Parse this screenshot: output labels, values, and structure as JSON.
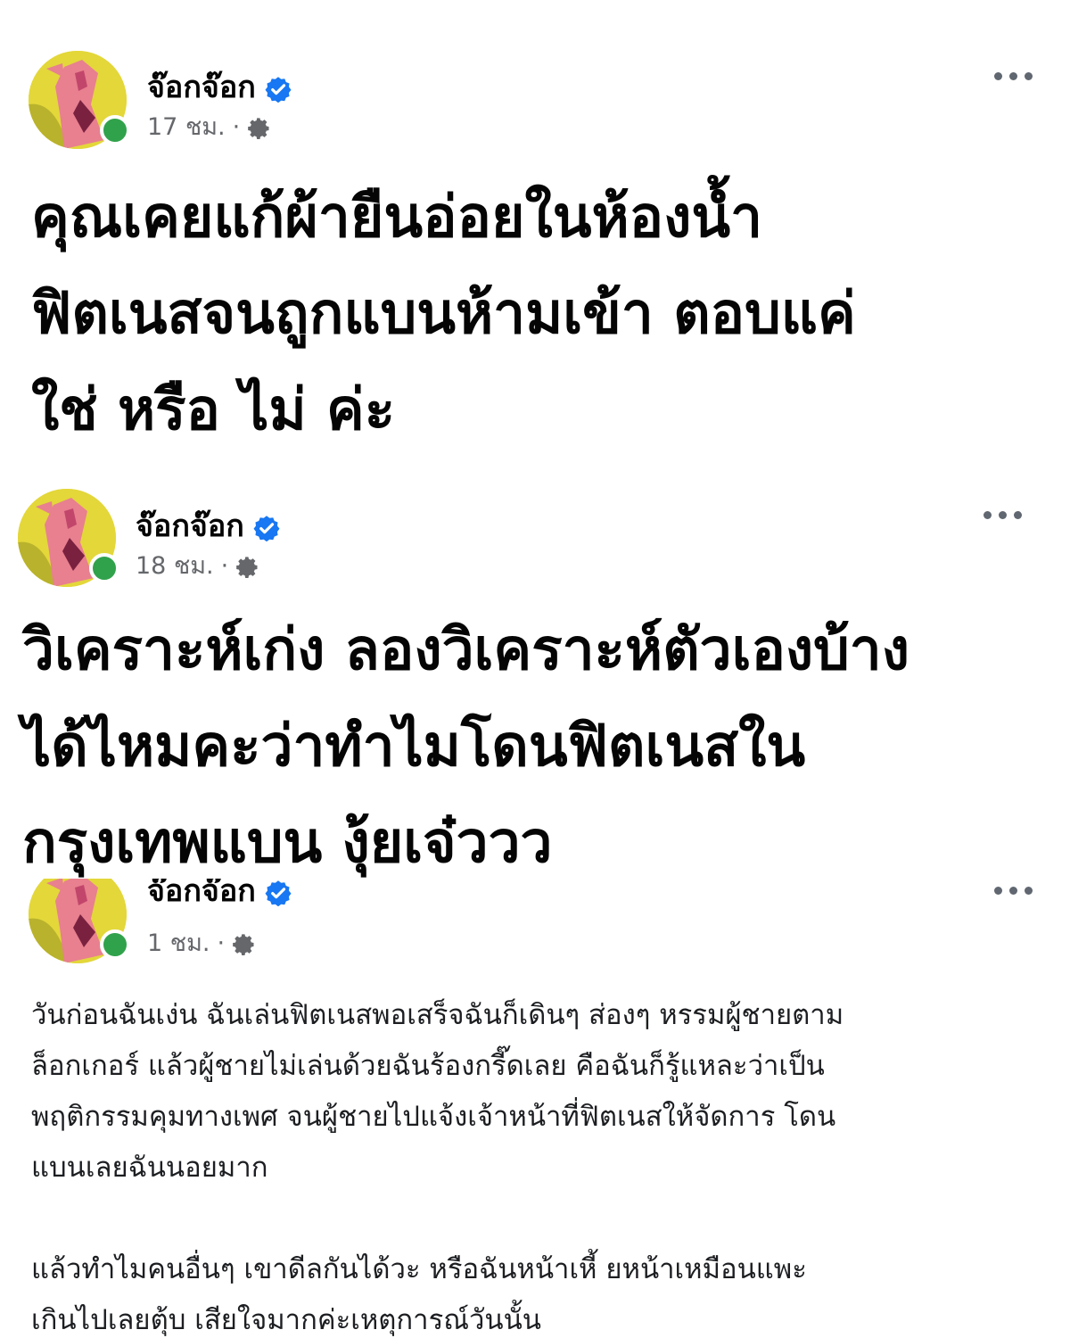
{
  "posts": [
    {
      "author": "จ๊อกจ๊อก",
      "time": "17 ชม.",
      "separator": "·",
      "lines": [
        "คุณเคยแก้ผ้ายืนอ่อยในห้องน้ำ",
        "ฟิตเนสจนถูกแบนห้ามเข้า ตอบแค่",
        "ใช่ หรือ ไม่ ค่ะ"
      ]
    },
    {
      "author": "จ๊อกจ๊อก",
      "time": "18 ชม.",
      "separator": "·",
      "lines": [
        "วิเคราะห์เก่ง ลองวิเคราะห์ตัวเองบ้าง",
        "ได้ไหมคะว่าทำไมโดนฟิตเนสใน",
        "กรุงเทพแบน งุ้ยเจ๋ววว"
      ]
    },
    {
      "author": "จ๊อกจ๊อก",
      "time": "1 ชม.",
      "separator": "·",
      "paragraph1": [
        "วันก่อนฉันเง่น ฉันเล่นฟิตเนสพอเสร็จฉันก็เดินๆ ส่องๆ หรรมผู้ชายตาม",
        "ล็อกเกอร์ แล้วผู้ชายไม่เล่นด้วยฉันร้องกรี๊ดเลย คือฉันก็รู้แหละว่าเป็น",
        "พฤติกรรมคุมทางเพศ จนผู้ชายไปแจ้งเจ้าหน้าที่ฟิตเนสให้จัดการ โดน",
        "แบนเลยฉันนอยมาก"
      ],
      "paragraph2": [
        "แล้วทำไมคนอื่นๆ เขาดีลกันได้วะ หรือฉันหน้าเหี้ ยหน้าเหมือนแพะ",
        "เกินไปเลยตุ้บ เสียใจมากค่ะเหตุการณ์วันนั้น"
      ]
    }
  ],
  "colors": {
    "verified": "#1877f2",
    "online": "#31a24c",
    "meta": "#65676b",
    "text": "#050505"
  },
  "icons": {
    "verified": "verified-badge-icon",
    "audience": "gear-icon",
    "more": "more-options-icon"
  }
}
